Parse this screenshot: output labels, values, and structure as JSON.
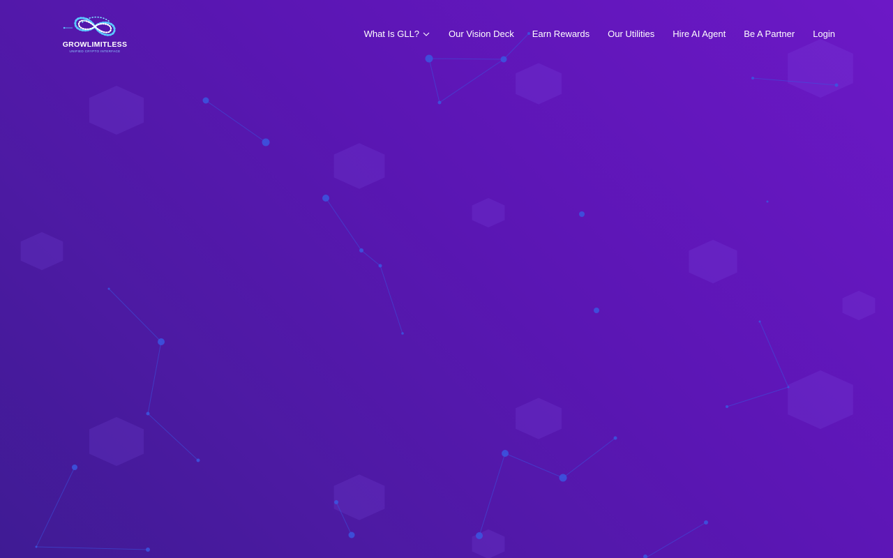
{
  "brand": {
    "name": "GROWLIMITLESS",
    "tagline": "UNIFIED CRYPTO INTERFACE",
    "logo_icon": "infinity-logo-icon"
  },
  "nav": {
    "items": [
      {
        "label": "What Is GLL?",
        "has_dropdown": true
      },
      {
        "label": "Our Vision Deck"
      },
      {
        "label": "Earn Rewards"
      },
      {
        "label": "Our Utilities"
      },
      {
        "label": "Hire AI Agent"
      },
      {
        "label": "Be A Partner"
      },
      {
        "label": "Login"
      }
    ],
    "dropdown_icon": "chevron-down-icon"
  },
  "colors": {
    "background_start": "#6c18c6",
    "background_end": "#3f1b94",
    "network_node": "#3b56e0",
    "nav_text": "#ffffff",
    "logo_accent": "#5bc8ff"
  }
}
